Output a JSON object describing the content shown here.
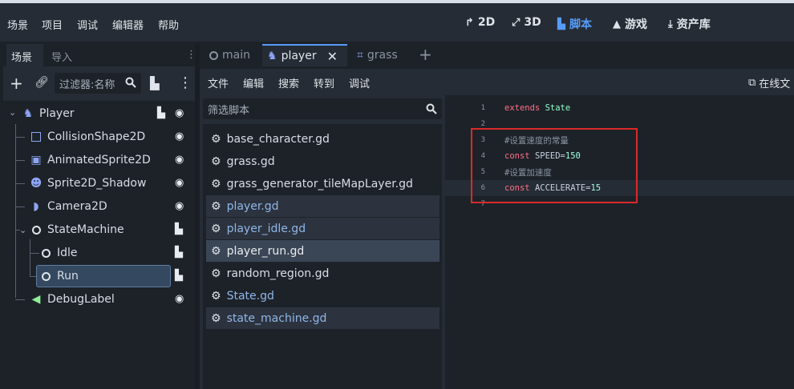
{
  "menubar": {
    "items": [
      "场景",
      "项目",
      "调试",
      "编辑器",
      "帮助"
    ]
  },
  "workspaces": {
    "items": [
      {
        "label": "2D",
        "icon": "2d-icon",
        "glyph": "↱"
      },
      {
        "label": "3D",
        "icon": "3d-icon",
        "glyph": "⤢"
      },
      {
        "label": "脚本",
        "icon": "script-icon",
        "glyph": "▙"
      },
      {
        "label": "游戏",
        "icon": "game-icon",
        "glyph": "▲"
      },
      {
        "label": "资产库",
        "icon": "asset-library-icon",
        "glyph": "⤓"
      }
    ],
    "active": "脚本"
  },
  "left_dock": {
    "tabs": [
      "场景",
      "导入"
    ],
    "filter_placeholder": "过滤器:名称",
    "tree": [
      {
        "label": "Player",
        "icon": "character-icon"
      },
      {
        "label": "CollisionShape2D",
        "icon": "collision-shape-icon"
      },
      {
        "label": "AnimatedSprite2D",
        "icon": "animated-sprite-icon"
      },
      {
        "label": "Sprite2D_Shadow",
        "icon": "sprite-icon"
      },
      {
        "label": "Camera2D",
        "icon": "camera-icon"
      },
      {
        "label": "StateMachine",
        "icon": "node-icon"
      },
      {
        "label": "Idle",
        "icon": "node-icon"
      },
      {
        "label": "Run",
        "icon": "node-icon"
      },
      {
        "label": "DebugLabel",
        "icon": "label-icon"
      }
    ],
    "selected": "Run"
  },
  "script_tabs": {
    "items": [
      {
        "label": "main",
        "icon": "node-icon"
      },
      {
        "label": "player",
        "icon": "character-icon"
      },
      {
        "label": "grass",
        "icon": "tilemap-icon"
      }
    ],
    "active": "player"
  },
  "script_menu": {
    "items": [
      "文件",
      "编辑",
      "搜索",
      "转到",
      "调试"
    ],
    "online_docs": "在线文"
  },
  "script_list": {
    "filter_placeholder": "筛选脚本",
    "items": [
      "base_character.gd",
      "grass.gd",
      "grass_generator_tileMapLayer.gd",
      "player.gd",
      "player_idle.gd",
      "player_run.gd",
      "random_region.gd",
      "State.gd",
      "state_machine.gd"
    ],
    "selected": "player_run.gd"
  },
  "editor": {
    "line_numbers": [
      "1",
      "2",
      "3",
      "4",
      "5",
      "6",
      "7"
    ],
    "line1_kw": "extends",
    "line1_cls": "State",
    "line3_comment": "#设置速度的常量",
    "line4_kw": "const",
    "line4_name": "SPEED=",
    "line4_val": "150",
    "line5_comment": "#设置加速度",
    "line6_kw": "const",
    "line6_name": "ACCELERATE=",
    "line6_val": "15",
    "highlight_color": "#d92a2a"
  }
}
